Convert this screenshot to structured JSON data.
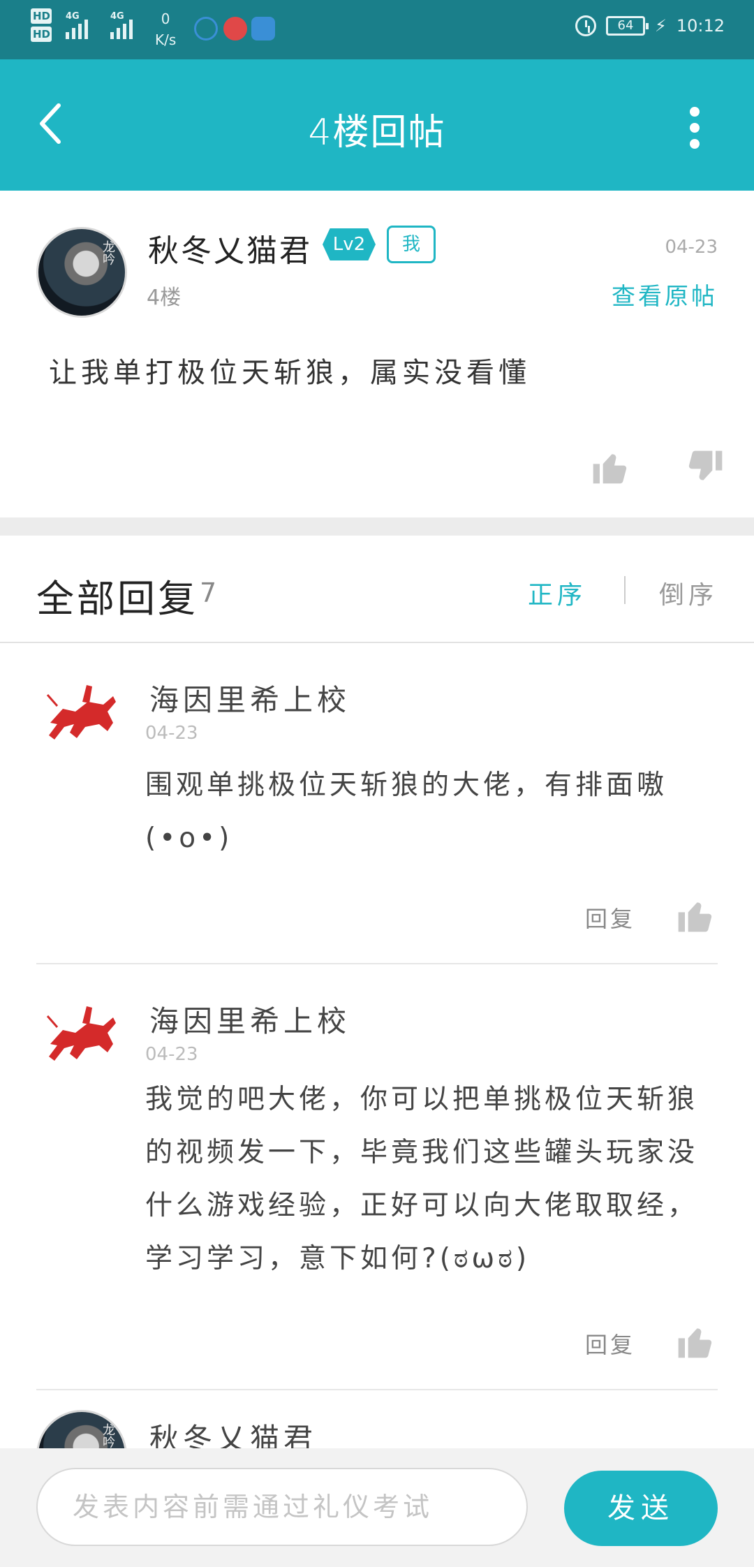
{
  "status_bar": {
    "net_label_1": "4G",
    "net_label_2": "4G",
    "speed_value": "0",
    "speed_unit": "K/s",
    "battery": "64",
    "time": "10:12"
  },
  "app_bar": {
    "title": "4楼回帖"
  },
  "post": {
    "author": "秋冬乂猫君",
    "level": "Lv2",
    "me_badge": "我",
    "date": "04-23",
    "floor": "4楼",
    "view_original": "查看原帖",
    "content": "让我单打极位天斩狼，属实没看懂"
  },
  "replies_header": {
    "title": "全部回复",
    "count": "7",
    "sort_asc": "正序",
    "sort_desc": "倒序"
  },
  "replies": [
    {
      "author": "海因里希上校",
      "date": "04-23",
      "content": "围观单挑极位天斩狼的大佬，有排面嗷(•o•)",
      "reply_label": "回复"
    },
    {
      "author": "海因里希上校",
      "date": "04-23",
      "content": "我觉的吧大佬，你可以把单挑极位天斩狼的视频发一下，毕竟我们这些罐头玩家没什么游戏经验，正好可以向大佬取取经，学习学习，意下如何?(ಠωಠ)",
      "reply_label": "回复"
    },
    {
      "author": "秋冬乂猫君"
    }
  ],
  "input_bar": {
    "placeholder": "发表内容前需通过礼仪考试",
    "send_label": "发送"
  },
  "colors": {
    "accent": "#1fb6c4",
    "status_bar": "#1a7f8a"
  }
}
